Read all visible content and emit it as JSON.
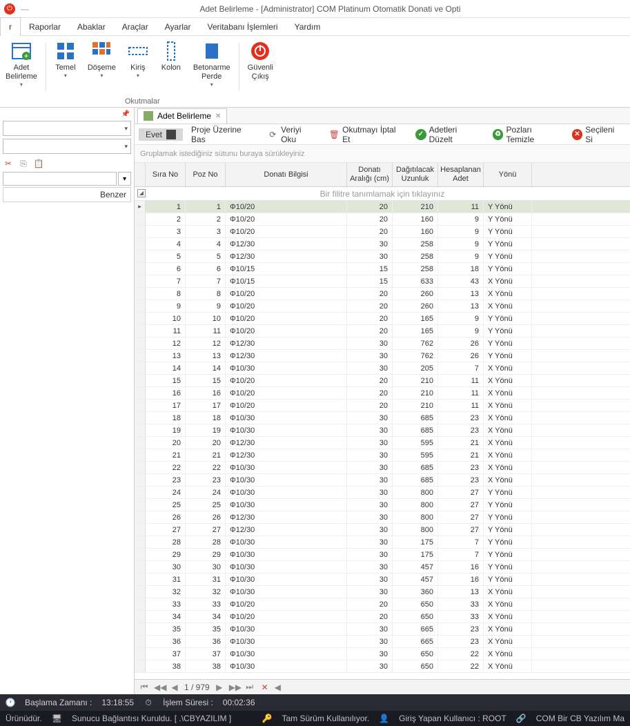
{
  "window": {
    "title": "Adet Belirleme - [Administrator] COM Platinum Otomatik Donati ve Opti"
  },
  "menubar": {
    "items": [
      "r",
      "Raporlar",
      "Abaklar",
      "Araçlar",
      "Ayarlar",
      "Veritabanı İşlemleri",
      "Yardım"
    ]
  },
  "ribbon": {
    "adet": "Adet\nBelirleme",
    "temel": "Temel",
    "doseme": "Döşeme",
    "kiris": "Kiriş",
    "kolon": "Kolon",
    "perde": "Betonarme\nPerde",
    "cikis": "Güvenli\nÇıkış",
    "group_label": "Okutmalar"
  },
  "tab": {
    "label": "Adet Belirleme"
  },
  "toolbar2": {
    "evet": "Evet",
    "proje": "Proje Üzerine Bas",
    "veriyi": "Veriyi Oku",
    "iptal": "Okutmayı İptal Et",
    "duzelt": "Adetleri Düzelt",
    "temizle": "Pozları Temizle",
    "secileni": "Seçileni Si"
  },
  "group_hint": "Gruplamak istediğiniz sütunu buraya sürükleyiniz",
  "filter_hint": "Bir filitre tanımlamak için tıklayınız",
  "columns": {
    "sira": "Sıra No",
    "poz": "Poz No",
    "donati": "Donatı Bilgisi",
    "aralik": "Donatı Aralığı (cm)",
    "dagit": "Dağıtılacak Uzunluk",
    "hesap": "Hesaplanan Adet",
    "yonu": "Yönü"
  },
  "rows": [
    {
      "sira": 1,
      "poz": 1,
      "donati": "Φ10/20",
      "aralik": 20,
      "dagit": 210,
      "hesap": 11,
      "yonu": "Y Yönü"
    },
    {
      "sira": 2,
      "poz": 2,
      "donati": "Φ10/20",
      "aralik": 20,
      "dagit": 160,
      "hesap": 9,
      "yonu": "Y Yönü"
    },
    {
      "sira": 3,
      "poz": 3,
      "donati": "Φ10/20",
      "aralik": 20,
      "dagit": 160,
      "hesap": 9,
      "yonu": "Y Yönü"
    },
    {
      "sira": 4,
      "poz": 4,
      "donati": "Φ12/30",
      "aralik": 30,
      "dagit": 258,
      "hesap": 9,
      "yonu": "Y Yönü"
    },
    {
      "sira": 5,
      "poz": 5,
      "donati": "Φ12/30",
      "aralik": 30,
      "dagit": 258,
      "hesap": 9,
      "yonu": "Y Yönü"
    },
    {
      "sira": 6,
      "poz": 6,
      "donati": "Φ10/15",
      "aralik": 15,
      "dagit": 258,
      "hesap": 18,
      "yonu": "Y Yönü"
    },
    {
      "sira": 7,
      "poz": 7,
      "donati": "Φ10/15",
      "aralik": 15,
      "dagit": 633,
      "hesap": 43,
      "yonu": "X Yönü"
    },
    {
      "sira": 8,
      "poz": 8,
      "donati": "Φ10/20",
      "aralik": 20,
      "dagit": 260,
      "hesap": 13,
      "yonu": "X Yönü"
    },
    {
      "sira": 9,
      "poz": 9,
      "donati": "Φ10/20",
      "aralik": 20,
      "dagit": 260,
      "hesap": 13,
      "yonu": "X Yönü"
    },
    {
      "sira": 10,
      "poz": 10,
      "donati": "Φ10/20",
      "aralik": 20,
      "dagit": 165,
      "hesap": 9,
      "yonu": "Y Yönü"
    },
    {
      "sira": 11,
      "poz": 11,
      "donati": "Φ10/20",
      "aralik": 20,
      "dagit": 165,
      "hesap": 9,
      "yonu": "Y Yönü"
    },
    {
      "sira": 12,
      "poz": 12,
      "donati": "Φ12/30",
      "aralik": 30,
      "dagit": 762,
      "hesap": 26,
      "yonu": "Y Yönü"
    },
    {
      "sira": 13,
      "poz": 13,
      "donati": "Φ12/30",
      "aralik": 30,
      "dagit": 762,
      "hesap": 26,
      "yonu": "Y Yönü"
    },
    {
      "sira": 14,
      "poz": 14,
      "donati": "Φ10/30",
      "aralik": 30,
      "dagit": 205,
      "hesap": 7,
      "yonu": "X Yönü"
    },
    {
      "sira": 15,
      "poz": 15,
      "donati": "Φ10/20",
      "aralik": 20,
      "dagit": 210,
      "hesap": 11,
      "yonu": "X Yönü"
    },
    {
      "sira": 16,
      "poz": 16,
      "donati": "Φ10/20",
      "aralik": 20,
      "dagit": 210,
      "hesap": 11,
      "yonu": "X Yönü"
    },
    {
      "sira": 17,
      "poz": 17,
      "donati": "Φ10/20",
      "aralik": 20,
      "dagit": 210,
      "hesap": 11,
      "yonu": "X Yönü"
    },
    {
      "sira": 18,
      "poz": 18,
      "donati": "Φ10/30",
      "aralik": 30,
      "dagit": 685,
      "hesap": 23,
      "yonu": "X Yönü"
    },
    {
      "sira": 19,
      "poz": 19,
      "donati": "Φ10/30",
      "aralik": 30,
      "dagit": 685,
      "hesap": 23,
      "yonu": "X Yönü"
    },
    {
      "sira": 20,
      "poz": 20,
      "donati": "Φ12/30",
      "aralik": 30,
      "dagit": 595,
      "hesap": 21,
      "yonu": "X Yönü"
    },
    {
      "sira": 21,
      "poz": 21,
      "donati": "Φ12/30",
      "aralik": 30,
      "dagit": 595,
      "hesap": 21,
      "yonu": "X Yönü"
    },
    {
      "sira": 22,
      "poz": 22,
      "donati": "Φ10/30",
      "aralik": 30,
      "dagit": 685,
      "hesap": 23,
      "yonu": "X Yönü"
    },
    {
      "sira": 23,
      "poz": 23,
      "donati": "Φ10/30",
      "aralik": 30,
      "dagit": 685,
      "hesap": 23,
      "yonu": "X Yönü"
    },
    {
      "sira": 24,
      "poz": 24,
      "donati": "Φ10/30",
      "aralik": 30,
      "dagit": 800,
      "hesap": 27,
      "yonu": "Y Yönü"
    },
    {
      "sira": 25,
      "poz": 25,
      "donati": "Φ10/30",
      "aralik": 30,
      "dagit": 800,
      "hesap": 27,
      "yonu": "Y Yönü"
    },
    {
      "sira": 26,
      "poz": 26,
      "donati": "Φ12/30",
      "aralik": 30,
      "dagit": 800,
      "hesap": 27,
      "yonu": "Y Yönü"
    },
    {
      "sira": 27,
      "poz": 27,
      "donati": "Φ12/30",
      "aralik": 30,
      "dagit": 800,
      "hesap": 27,
      "yonu": "Y Yönü"
    },
    {
      "sira": 28,
      "poz": 28,
      "donati": "Φ10/30",
      "aralik": 30,
      "dagit": 175,
      "hesap": 7,
      "yonu": "Y Yönü"
    },
    {
      "sira": 29,
      "poz": 29,
      "donati": "Φ10/30",
      "aralik": 30,
      "dagit": 175,
      "hesap": 7,
      "yonu": "Y Yönü"
    },
    {
      "sira": 30,
      "poz": 30,
      "donati": "Φ10/30",
      "aralik": 30,
      "dagit": 457,
      "hesap": 16,
      "yonu": "Y Yönü"
    },
    {
      "sira": 31,
      "poz": 31,
      "donati": "Φ10/30",
      "aralik": 30,
      "dagit": 457,
      "hesap": 16,
      "yonu": "Y Yönü"
    },
    {
      "sira": 32,
      "poz": 32,
      "donati": "Φ10/30",
      "aralik": 30,
      "dagit": 360,
      "hesap": 13,
      "yonu": "X Yönü"
    },
    {
      "sira": 33,
      "poz": 33,
      "donati": "Φ10/20",
      "aralik": 20,
      "dagit": 650,
      "hesap": 33,
      "yonu": "X Yönü"
    },
    {
      "sira": 34,
      "poz": 34,
      "donati": "Φ10/20",
      "aralik": 20,
      "dagit": 650,
      "hesap": 33,
      "yonu": "X Yönü"
    },
    {
      "sira": 35,
      "poz": 35,
      "donati": "Φ10/30",
      "aralik": 30,
      "dagit": 665,
      "hesap": 23,
      "yonu": "X Yönü"
    },
    {
      "sira": 36,
      "poz": 36,
      "donati": "Φ10/30",
      "aralik": 30,
      "dagit": 665,
      "hesap": 23,
      "yonu": "X Yönü"
    },
    {
      "sira": 37,
      "poz": 37,
      "donati": "Φ10/30",
      "aralik": 30,
      "dagit": 650,
      "hesap": 22,
      "yonu": "X Yönü"
    },
    {
      "sira": 38,
      "poz": 38,
      "donati": "Φ10/30",
      "aralik": 30,
      "dagit": 650,
      "hesap": 22,
      "yonu": "X Yönü"
    }
  ],
  "pager": {
    "position": "1 / 979"
  },
  "left": {
    "benzer": "Benzer"
  },
  "status1": {
    "baslama_label": "Başlama Zamanı :",
    "baslama_val": "13:18:55",
    "islem_label": "İşlem Süresi :",
    "islem_val": "00:02:36"
  },
  "status2": {
    "urun": "Ürünüdür.",
    "sunucu": "Sunucu Bağlantısı Kuruldu. [ .\\CBYAZILIM ]",
    "tam": "Tam Sürüm Kullanılıyor.",
    "giris": "Giriş Yapan Kullanıcı : ROOT",
    "com": "COM Bir CB Yazılım Ma"
  }
}
